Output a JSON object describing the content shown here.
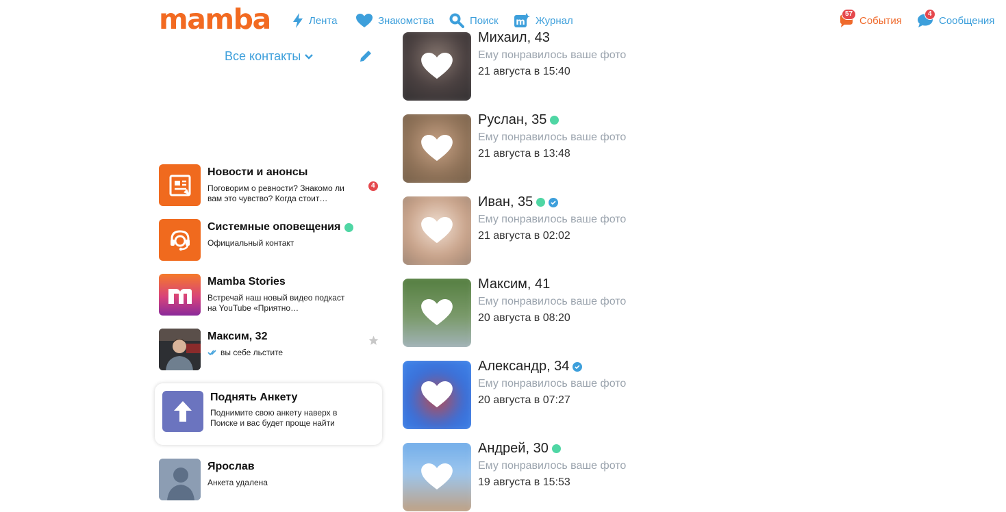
{
  "brand": {
    "logo_text": "mamba",
    "accent": "#f26a21",
    "link_color": "#3d9fdb"
  },
  "nav": {
    "feed": "Лента",
    "dating": "Знакомства",
    "search": "Поиск",
    "journal": "Журнал",
    "events": {
      "label": "События",
      "count": "57"
    },
    "messages": {
      "label": "Сообщения",
      "count": "4"
    }
  },
  "sidebar": {
    "filter_label": "Все контакты",
    "chats": [
      {
        "name": "Новости и анонсы",
        "message": "Поговорим о ревности? Знакомо ли вам это чувство? Когда стоит…",
        "unread": "4",
        "icon": "news-icon"
      },
      {
        "name": "Системные оповещения",
        "message": "Официальный контакт",
        "online": true,
        "icon": "support-headset-icon"
      },
      {
        "name": "Mamba Stories",
        "message": "Встречай наш новый видео подкаст на YouTube «Приятно…",
        "icon": "mamba-stories-logo"
      },
      {
        "name": "Максим, 32",
        "message": "вы себе льстите",
        "read": true,
        "icon": "star-icon"
      }
    ],
    "promo": {
      "title": "Поднять Анкету",
      "text": "Поднимите свою анкету наверх в Поиске и вас будет проще найти",
      "icon": "arrow-up-icon"
    },
    "deleted": {
      "name": "Ярослав",
      "message": "Анкета удалена"
    }
  },
  "likes": [
    {
      "title": "Михаил, 43",
      "subtitle": "Ему понравилось ваше фото",
      "date": "21 августа в 15:40",
      "online": false,
      "verified": false
    },
    {
      "title": "Руслан, 35",
      "subtitle": "Ему понравилось ваше фото",
      "date": "21 августа в 13:48",
      "online": true,
      "verified": false
    },
    {
      "title": "Иван, 35",
      "subtitle": "Ему понравилось ваше фото",
      "date": "21 августа в 02:02",
      "online": true,
      "verified": true
    },
    {
      "title": "Максим, 41",
      "subtitle": "Ему понравилось ваше фото",
      "date": "20 августа в 08:20",
      "online": false,
      "verified": false
    },
    {
      "title": "Александр, 34",
      "subtitle": "Ему понравилось ваше фото",
      "date": "20 августа в 07:27",
      "online": false,
      "verified": true
    },
    {
      "title": "Андрей, 30",
      "subtitle": "Ему понравилось ваше фото",
      "date": "19 августа в 15:53",
      "online": true,
      "verified": false
    }
  ]
}
